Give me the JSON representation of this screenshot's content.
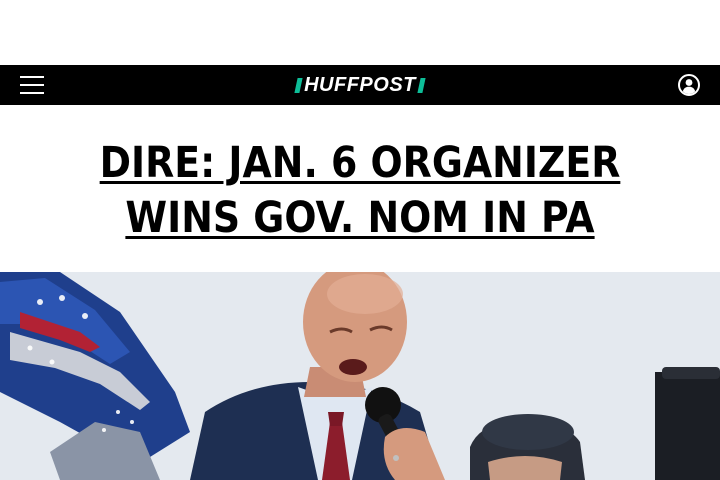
{
  "site": {
    "logo_text": "HUFFPOST",
    "brand_accent": "#0dbe98"
  },
  "nav": {
    "menu_icon": "hamburger-menu-icon",
    "account_icon": "user-account-icon"
  },
  "headline": {
    "line1": "DIRE: JAN. 6 ORGANIZER",
    "line2": "WINS GOV. NOM IN PA"
  },
  "hero_image": {
    "description_icon": "photo"
  }
}
